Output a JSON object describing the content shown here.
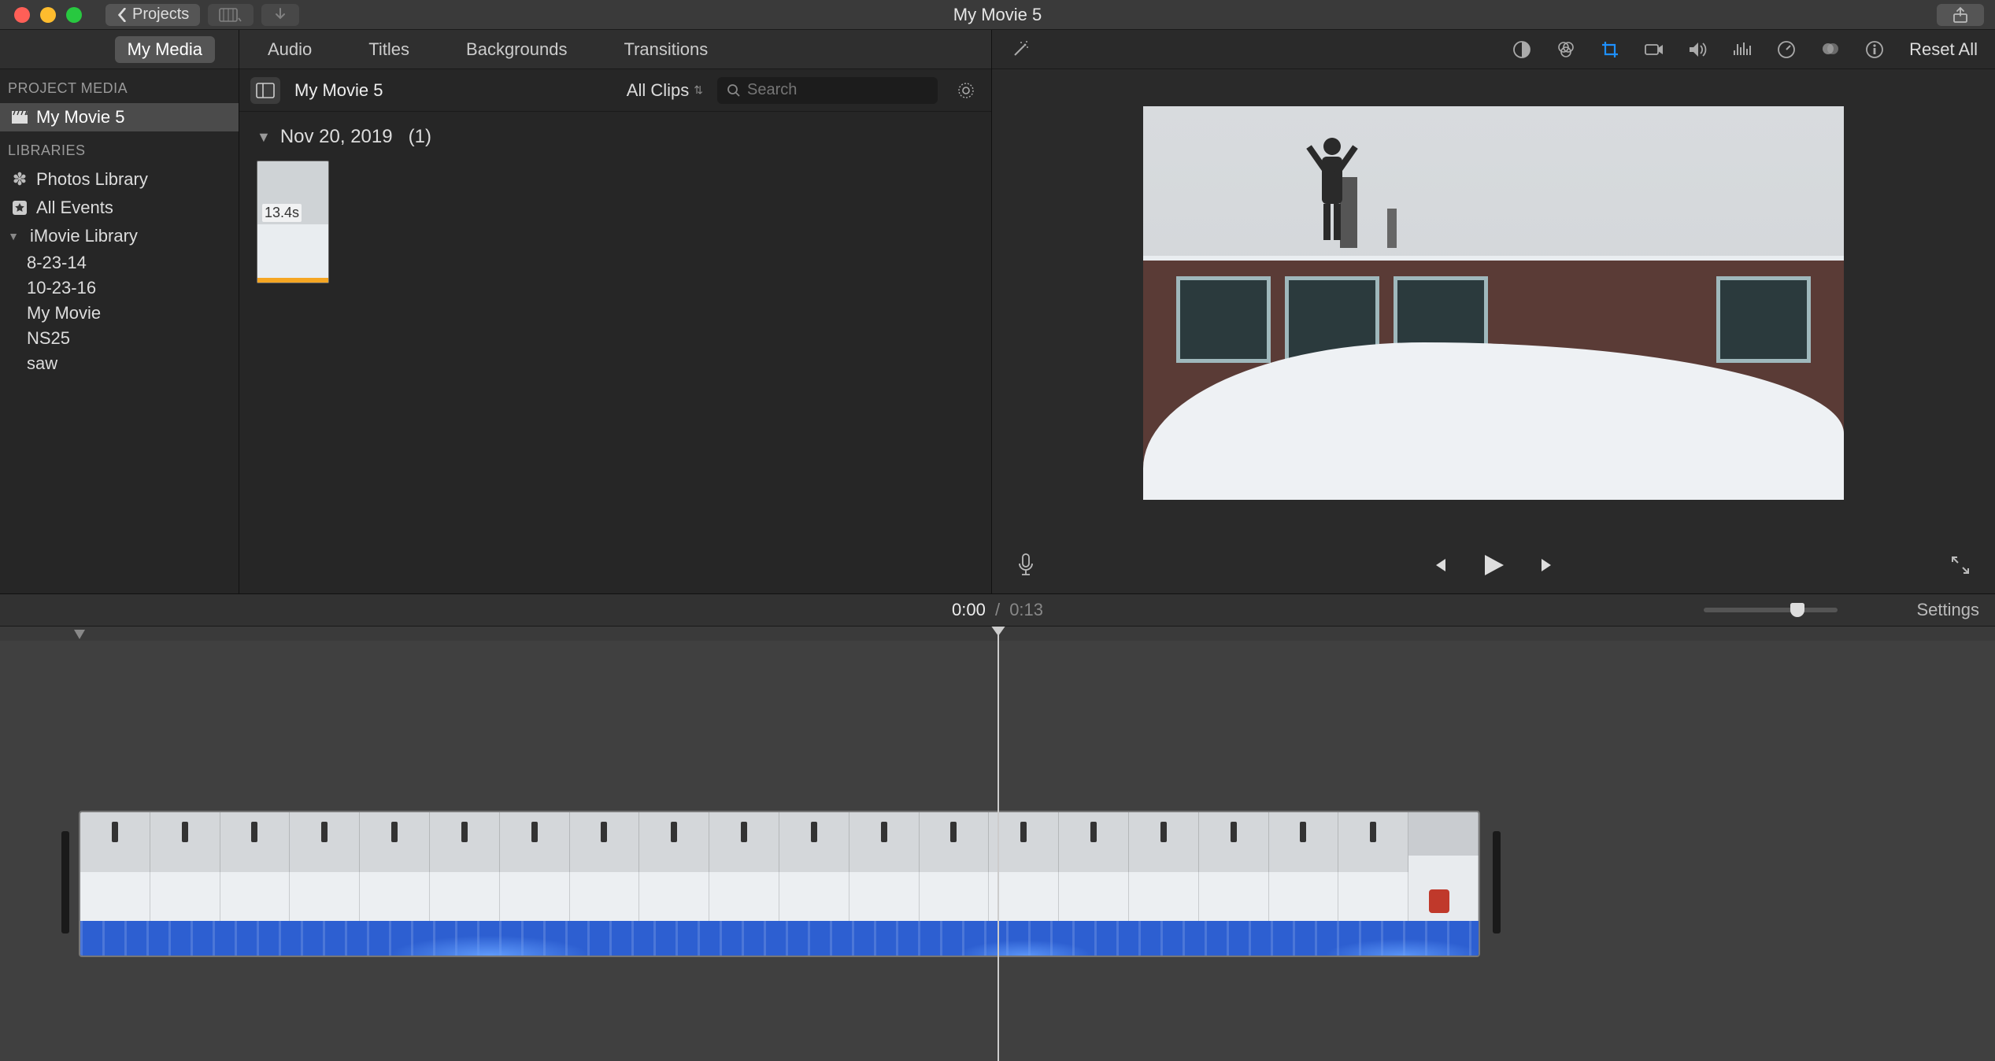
{
  "titlebar": {
    "projects_label": "Projects",
    "window_title": "My Movie 5"
  },
  "tabs": {
    "my_media": "My Media",
    "audio": "Audio",
    "titles": "Titles",
    "backgrounds": "Backgrounds",
    "transitions": "Transitions"
  },
  "sidebar": {
    "project_media_header": "PROJECT MEDIA",
    "current_project": "My Movie 5",
    "libraries_header": "LIBRARIES",
    "photos_library": "Photos Library",
    "all_events": "All Events",
    "imovie_library": "iMovie Library",
    "events": [
      "8-23-14",
      "10-23-16",
      "My Movie",
      "NS25",
      "saw"
    ]
  },
  "browser": {
    "title": "My Movie 5",
    "filter_label": "All Clips",
    "search_placeholder": "Search",
    "event_date": "Nov 20, 2019",
    "event_count": "(1)",
    "clip_duration": "13.4s"
  },
  "viewer": {
    "reset_label": "Reset All"
  },
  "timeline": {
    "current_time": "0:00",
    "separator": "/",
    "total_time": "0:13",
    "settings_label": "Settings"
  }
}
